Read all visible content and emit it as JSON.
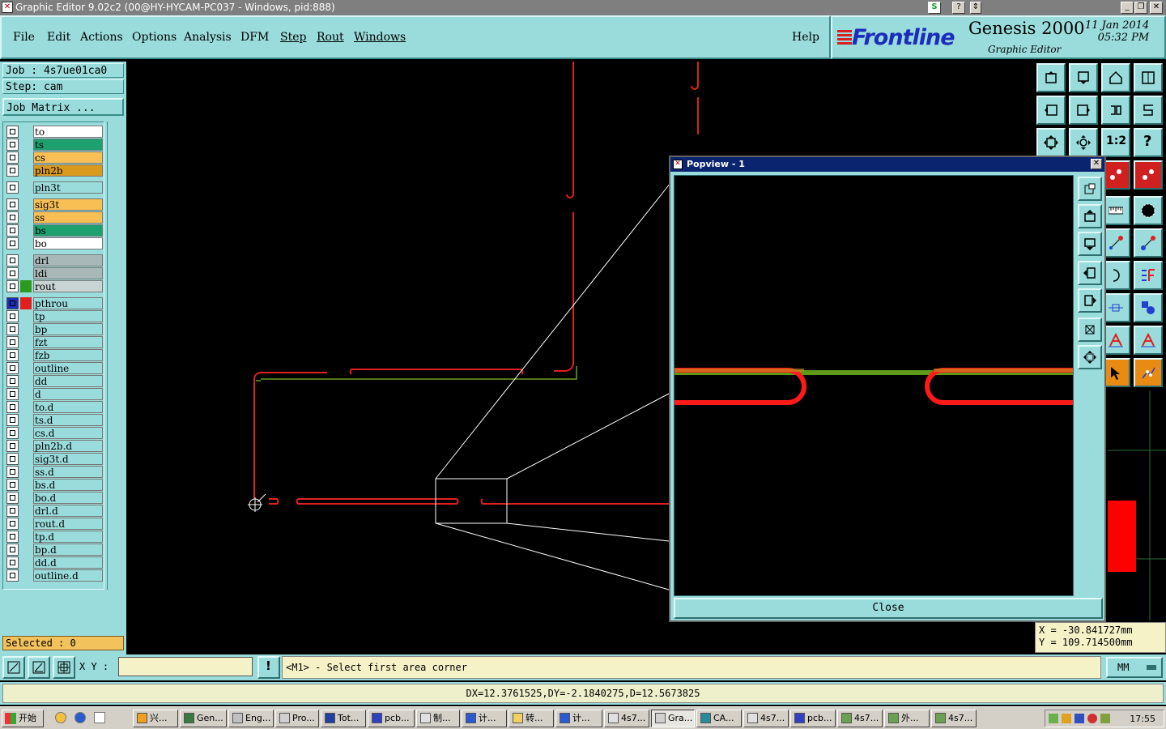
{
  "window": {
    "title": "Graphic Editor 9.02c2 (00@HY-HYCAM-PC037 - Windows, pid:888)"
  },
  "menu": [
    "File",
    "Edit",
    "Actions",
    "Options",
    "Analysis",
    "DFM",
    "Step",
    "Rout",
    "Windows"
  ],
  "help": "Help",
  "brand": {
    "logo": "Frontline",
    "product": "Genesis 2000",
    "subtitle": "Graphic Editor",
    "date": "11 Jan 2014",
    "time": "05:32 PM"
  },
  "job": {
    "job": "Job : 4s7ue01ca0",
    "step": "Step: cam",
    "matrix_button": "Job Matrix ..."
  },
  "layers": [
    {
      "name": "to",
      "color": "#ffffff"
    },
    {
      "name": "ts",
      "color": "#1ea070"
    },
    {
      "name": "cs",
      "color": "#f7bf54"
    },
    {
      "name": "pln2b",
      "color": "#d99a1e"
    },
    {
      "name": "pln3t",
      "color": "#9adcdc"
    },
    {
      "name": "sig3t",
      "color": "#f7bf54"
    },
    {
      "name": "ss",
      "color": "#f7bf54"
    },
    {
      "name": "bs",
      "color": "#1ea070"
    },
    {
      "name": "bo",
      "color": "#ffffff"
    },
    {
      "name": "drl",
      "color": "#a8b8b8"
    },
    {
      "name": "ldi",
      "color": "#a8b8b8"
    },
    {
      "name": "rout",
      "color": "#c8d4d4"
    },
    {
      "name": "pthrou",
      "color": "#9adcdc"
    },
    {
      "name": "tp",
      "color": "#9adcdc"
    },
    {
      "name": "bp",
      "color": "#9adcdc"
    },
    {
      "name": "fzt",
      "color": "#9adcdc"
    },
    {
      "name": "fzb",
      "color": "#9adcdc"
    },
    {
      "name": "outline",
      "color": "#9adcdc"
    },
    {
      "name": "dd",
      "color": "#9adcdc"
    },
    {
      "name": "d",
      "color": "#9adcdc"
    },
    {
      "name": "to.d",
      "color": "#9adcdc"
    },
    {
      "name": "ts.d",
      "color": "#9adcdc"
    },
    {
      "name": "cs.d",
      "color": "#9adcdc"
    },
    {
      "name": "pln2b.d",
      "color": "#9adcdc"
    },
    {
      "name": "sig3t.d",
      "color": "#9adcdc"
    },
    {
      "name": "ss.d",
      "color": "#9adcdc"
    },
    {
      "name": "bs.d",
      "color": "#9adcdc"
    },
    {
      "name": "bo.d",
      "color": "#9adcdc"
    },
    {
      "name": "drl.d",
      "color": "#9adcdc"
    },
    {
      "name": "rout.d",
      "color": "#9adcdc"
    },
    {
      "name": "tp.d",
      "color": "#9adcdc"
    },
    {
      "name": "bp.d",
      "color": "#9adcdc"
    },
    {
      "name": "dd.d",
      "color": "#9adcdc"
    },
    {
      "name": "outline.d",
      "color": "#9adcdc"
    }
  ],
  "selected": "Selected : 0",
  "popview": {
    "title": "Popview - 1",
    "close": "Close"
  },
  "coords": {
    "x": "X = -30.841727mm",
    "y": "Y = 109.714500mm"
  },
  "command": {
    "xy_label": "X Y :",
    "xy_value": "",
    "prompt": "<M1> - Select first area corner",
    "unit": "MM"
  },
  "measure": "DX=12.3761525,DY=-2.1840275,D=12.5673825",
  "taskbar": {
    "start": "开始",
    "tasks": [
      "兴...",
      "Gen...",
      "Eng...",
      "Pro...",
      "Tot...",
      "pcb...",
      "制...",
      "计...",
      "转...",
      "计...",
      "4s7...",
      "Gra...",
      "CA...",
      "4s7...",
      "pcb...",
      "4s7...",
      "外...",
      "4s7..."
    ],
    "clock": "17:55"
  }
}
